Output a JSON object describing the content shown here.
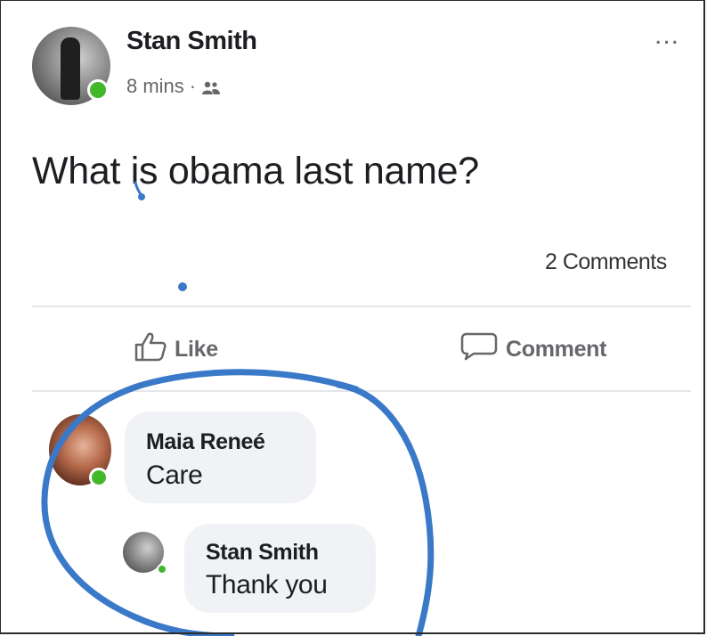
{
  "post": {
    "author": "Stan Smith",
    "time": "8 mins",
    "separator": "·",
    "audience_icon": "friends-icon",
    "more_label": "...",
    "text": "What is obama last name?",
    "comments_count": "2 Comments"
  },
  "actions": {
    "like_label": "Like",
    "like_icon": "thumbs-up-icon",
    "comment_label": "Comment",
    "comment_icon": "speech-bubble-icon"
  },
  "comments": [
    {
      "author": "Maia Reneé",
      "text": "Care"
    },
    {
      "author": "Stan Smith",
      "text": "Thank you"
    }
  ],
  "colors": {
    "online": "#42b72a",
    "annotation_ink": "#3a78c8",
    "bubble_bg": "#f0f2f5",
    "secondary_text": "#65676b"
  }
}
